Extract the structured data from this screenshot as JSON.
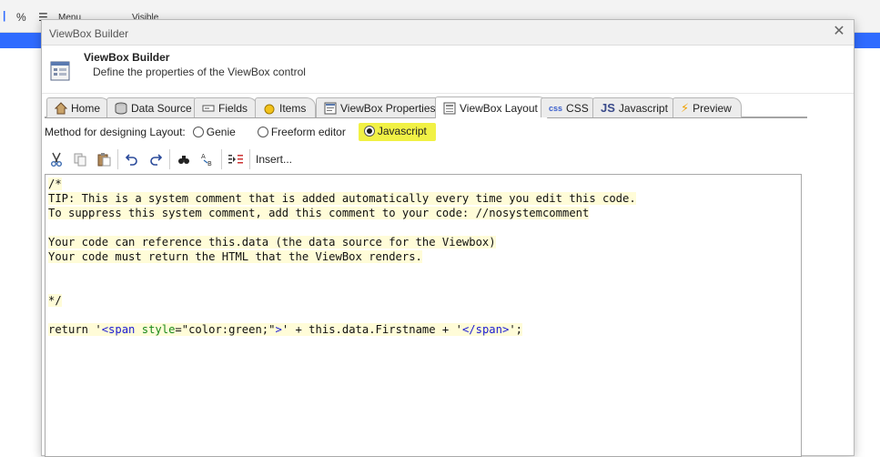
{
  "background_toolbar": {
    "percent": "%",
    "menu_label": "Menu",
    "visible_label": "Visible"
  },
  "dialog": {
    "window_title": "ViewBox Builder",
    "header_title": "ViewBox Builder",
    "header_subtitle": "Define the properties of the ViewBox control"
  },
  "tabs": [
    {
      "label": "Home",
      "icon": "home-icon"
    },
    {
      "label": "Data Source",
      "icon": "database-icon"
    },
    {
      "label": "Fields",
      "icon": "fields-icon"
    },
    {
      "label": "Items",
      "icon": "items-icon"
    },
    {
      "label": "ViewBox Properties",
      "icon": "properties-icon"
    },
    {
      "label": "ViewBox Layout",
      "icon": "layout-icon",
      "active": true
    },
    {
      "label": "CSS",
      "icon": "css-icon"
    },
    {
      "label": "Javascript",
      "icon": "js-icon"
    },
    {
      "label": "Preview",
      "icon": "lightning-icon"
    }
  ],
  "method": {
    "label": "Method for designing Layout:",
    "options": [
      "Genie",
      "Freeform editor",
      "Javascript"
    ],
    "selected": "Javascript"
  },
  "editor_toolbar": {
    "insert_label": "Insert..."
  },
  "code_lines": [
    "/*",
    "TIP: This is a system comment that is added automatically every time you edit this code.",
    "To suppress this system comment, add this comment to your code: //nosystemcomment",
    "",
    "Your code can reference this.data (the data source for the Viewbox)",
    "Your code must return the HTML that the ViewBox renders.",
    "",
    "",
    "*/",
    ""
  ],
  "code_return": {
    "prefix": "return '",
    "open_tag": "<span",
    "attr_name": " style",
    "attr_value": "=\"color:green;\"",
    "close_open": ">",
    "middle": "' + this.data.Firstname + '",
    "end_tag": "</span>",
    "suffix": "';"
  },
  "colors": {
    "accent_blue": "#2f6bff",
    "highlight_yellow": "#f1f145",
    "code_tag": "#1b1bd1",
    "code_attr": "#1b8a1b"
  }
}
